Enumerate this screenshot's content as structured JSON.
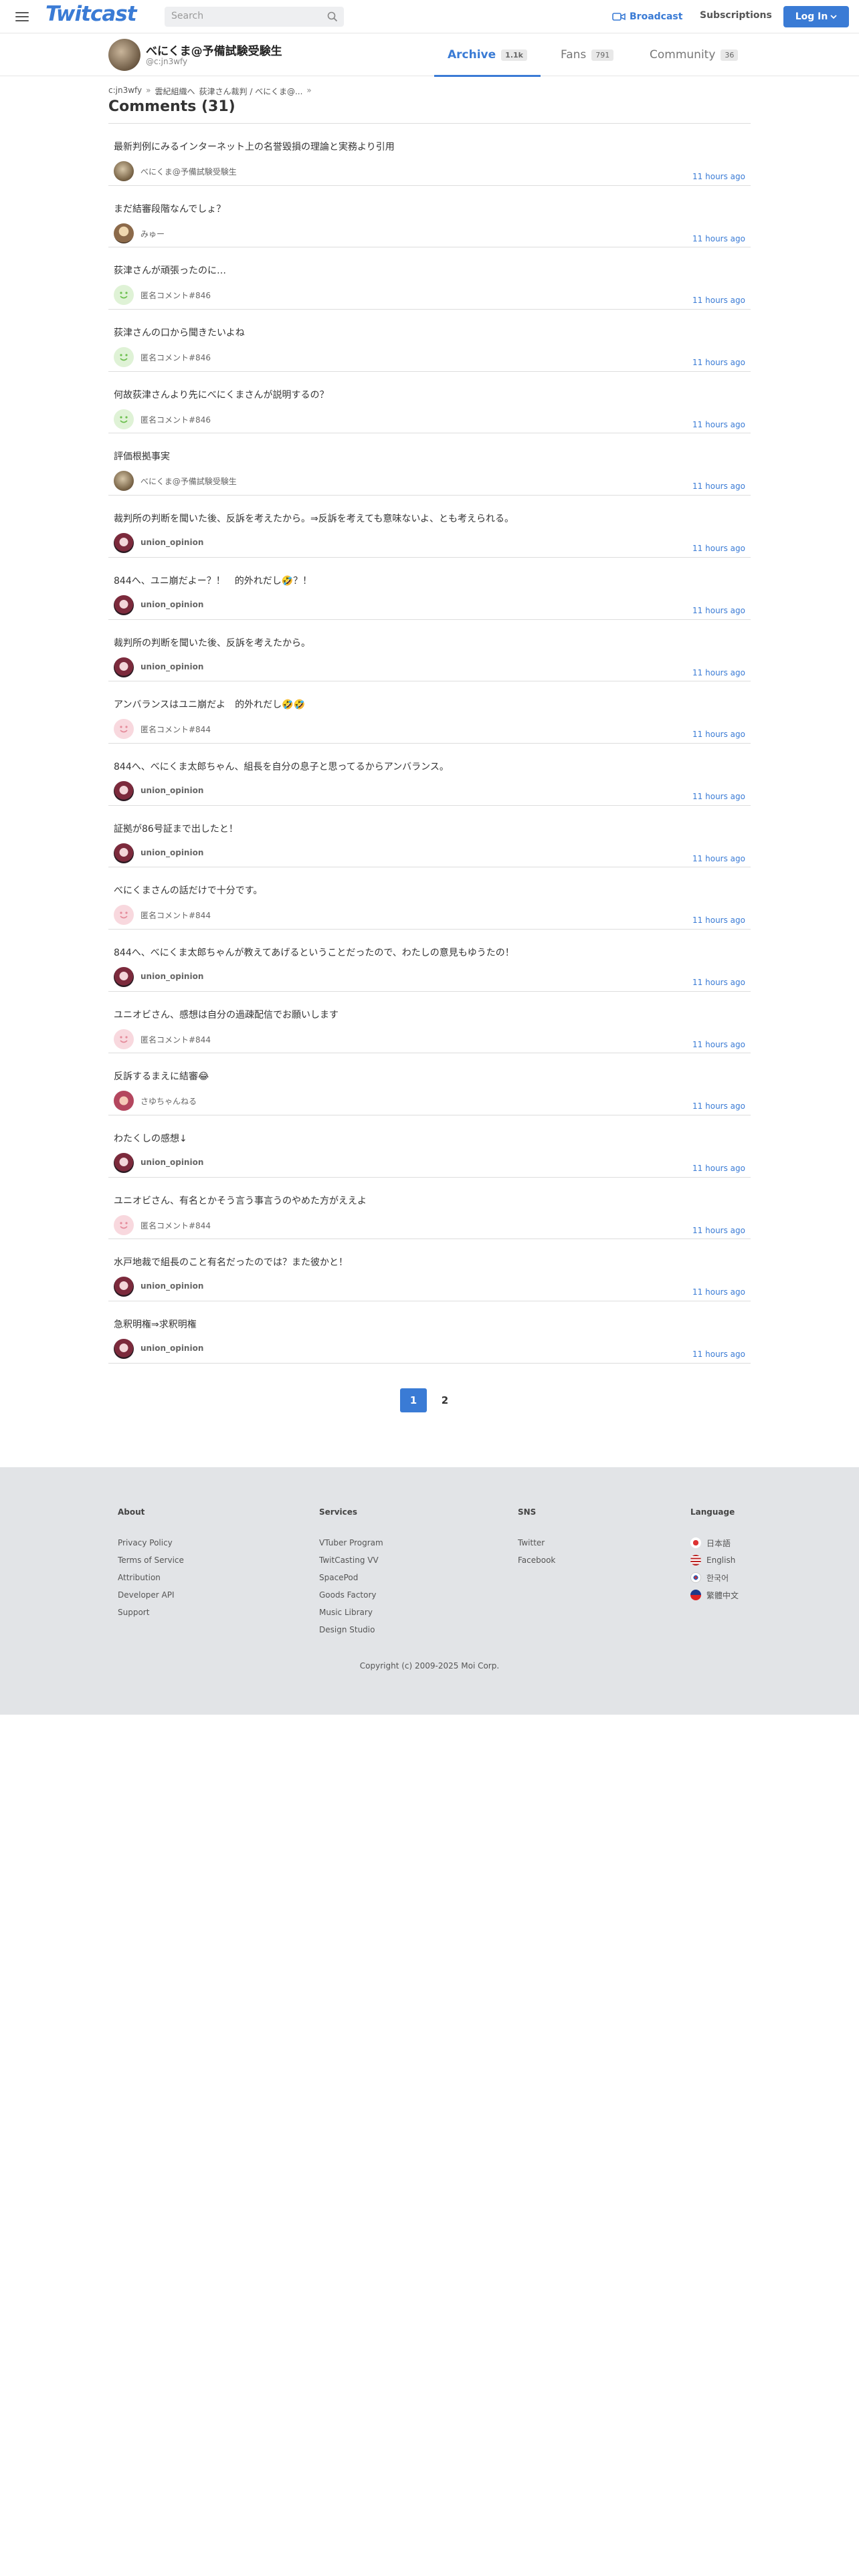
{
  "header": {
    "logo": "Twitcast",
    "search_placeholder": "Search",
    "broadcast_label": "Broadcast",
    "subscriptions_label": "Subscriptions",
    "login_label": "Log In",
    "accent_color": "#3a7bd5"
  },
  "profile": {
    "name": "べにくま@予備試験受験生",
    "id": "@c:jn3wfy",
    "tabs": [
      {
        "label": "Archive",
        "count": "1.1k"
      },
      {
        "label": "Fans",
        "count": "791"
      },
      {
        "label": "Community",
        "count": "36"
      }
    ]
  },
  "breadcrumb": [
    "c:jn3wfy",
    "»",
    "雲紀組織へ",
    "荻津さん裁判 / べにくま@...",
    "»"
  ],
  "page_title": "Comments (31)",
  "comments": [
    {
      "text": "最新判例にみるインターネット上の名誉毀損の理論と実務より引用",
      "user": "べにくま@予備試験受験生",
      "avatar": "photo",
      "time": "11 hours ago"
    },
    {
      "text": "まだ結審段階なんでしょ？",
      "user": "みゅー",
      "avatar": "miyu",
      "time": "11 hours ago"
    },
    {
      "text": "荻津さんが頑張ったのに…",
      "user": "匿名コメント#846",
      "avatar": "green",
      "time": "11 hours ago"
    },
    {
      "text": "荻津さんの口から聞きたいよね",
      "user": "匿名コメント#846",
      "avatar": "green",
      "time": "11 hours ago"
    },
    {
      "text": "何故荻津さんより先にべにくまさんが説明するの？",
      "user": "匿名コメント#846",
      "avatar": "green",
      "time": "11 hours ago"
    },
    {
      "text": "評価根拠事実",
      "user": "べにくま@予備試験受験生",
      "avatar": "photo",
      "time": "11 hours ago"
    },
    {
      "text": "裁判所の判断を聞いた後、反訴を考えたから。⇒反訴を考えても意味ないよ、とも考えられる。",
      "user": "union_opinion",
      "avatar": "union",
      "time": "11 hours ago"
    },
    {
      "text": "844へ、ユニ崩だよー？！　的外れだし🤣？！",
      "user": "union_opinion",
      "avatar": "union",
      "time": "11 hours ago"
    },
    {
      "text": "裁判所の判断を聞いた後、反訴を考えたから。",
      "user": "union_opinion",
      "avatar": "union",
      "time": "11 hours ago"
    },
    {
      "text": "アンバランスはユニ崩だよ　的外れだし🤣🤣",
      "user": "匿名コメント#844",
      "avatar": "pink",
      "time": "11 hours ago"
    },
    {
      "text": "844へ、べにくま太郎ちゃん、組長を自分の息子と思ってるからアンバランス。",
      "user": "union_opinion",
      "avatar": "union",
      "time": "11 hours ago"
    },
    {
      "text": "証拠が86号証まで出したと！",
      "user": "union_opinion",
      "avatar": "union",
      "time": "11 hours ago"
    },
    {
      "text": "べにくまさんの話だけで十分です。",
      "user": "匿名コメント#844",
      "avatar": "pink",
      "time": "11 hours ago"
    },
    {
      "text": "844へ、べにくま太郎ちゃんが教えてあげるということだったので、わたしの意見もゆうたの！",
      "user": "union_opinion",
      "avatar": "union",
      "time": "11 hours ago"
    },
    {
      "text": "ユニオビさん、感想は自分の過疎配信でお願いします",
      "user": "匿名コメント#844",
      "avatar": "pink",
      "time": "11 hours ago"
    },
    {
      "text": "反訴するまえに結審😂",
      "user": "さゆちゃんねる",
      "avatar": "sayu",
      "time": "11 hours ago"
    },
    {
      "text": "わたくしの感想↓",
      "user": "union_opinion",
      "avatar": "union",
      "time": "11 hours ago"
    },
    {
      "text": "ユニオビさん、有名とかそう言う事言うのやめた方がええよ",
      "user": "匿名コメント#844",
      "avatar": "pink",
      "time": "11 hours ago"
    },
    {
      "text": "水戸地裁で組長のこと有名だったのでは？また彼かと！",
      "user": "union_opinion",
      "avatar": "union",
      "time": "11 hours ago"
    },
    {
      "text": "急釈明権⇒求釈明権",
      "user": "union_opinion",
      "avatar": "union",
      "time": "11 hours ago"
    }
  ],
  "pagination": {
    "pages": [
      "1",
      "2"
    ],
    "current": "1"
  },
  "footer": {
    "about": {
      "heading": "About",
      "links": [
        "Privacy Policy",
        "Terms of Service",
        "Attribution",
        "Developer API",
        "Support"
      ]
    },
    "services": {
      "heading": "Services",
      "links": [
        "VTuber Program",
        "TwitCasting VV",
        "SpacePod",
        "Goods Factory",
        "Music Library",
        "Design Studio"
      ]
    },
    "sns": {
      "heading": "SNS",
      "links": [
        "Twitter",
        "Facebook"
      ]
    },
    "language": {
      "heading": "Language",
      "links": [
        "日本語",
        "English",
        "한국어",
        "繁體中文"
      ]
    },
    "copyright": "Copyright (c) 2009-2025 Moi Corp."
  }
}
